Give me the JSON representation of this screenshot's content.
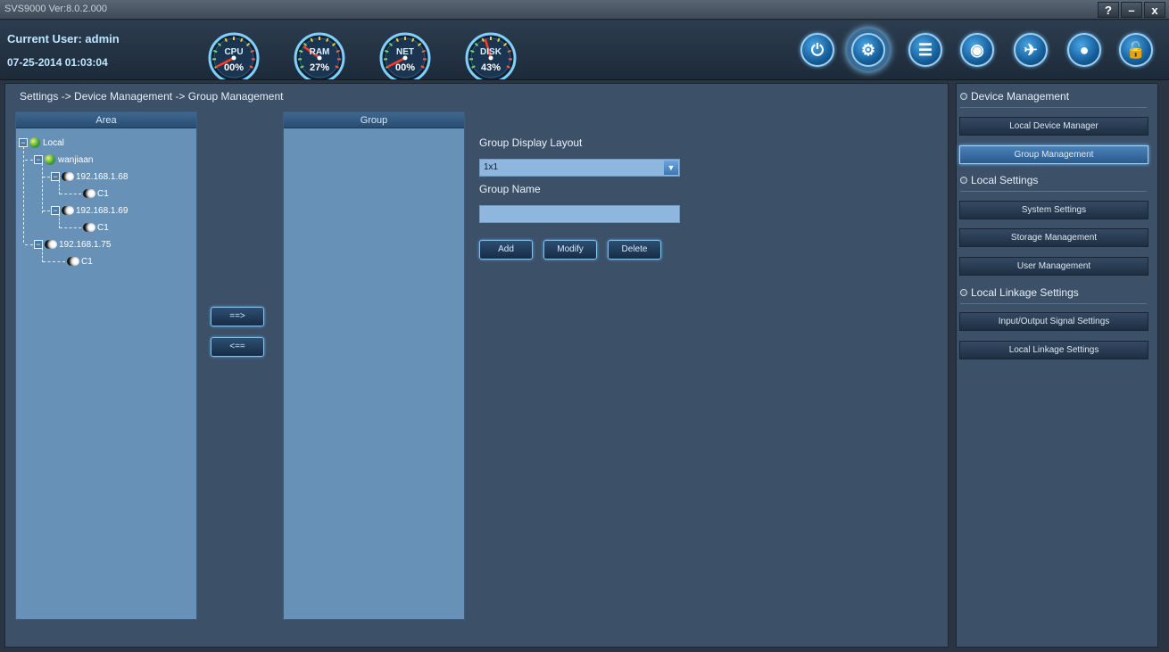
{
  "window": {
    "title": "SVS9000 Ver:8.0.2.000",
    "buttons": [
      "?",
      "–",
      "x"
    ]
  },
  "header": {
    "current_user": "Current User: admin",
    "datetime": "07-25-2014 01:03:04",
    "gauges": [
      {
        "label": "CPU",
        "value": "00%",
        "level": 0
      },
      {
        "label": "RAM",
        "value": "27%",
        "level": 0.27
      },
      {
        "label": "NET",
        "value": "00%",
        "level": 0
      },
      {
        "label": "DISK",
        "value": "43%",
        "level": 0.43
      }
    ],
    "toolbar_icons": [
      "power-icon",
      "settings-icon",
      "log-search-icon",
      "playback-icon",
      "map-icon",
      "camera-icon",
      "lock-icon"
    ]
  },
  "breadcrumb": "Settings -> Device Management -> Group Management",
  "area_panel": {
    "header": "Area",
    "tree": [
      {
        "label": "Local",
        "type": "globe"
      },
      {
        "label": "wanjiaan",
        "type": "globe"
      },
      {
        "label": "192.168.1.68",
        "type": "device"
      },
      {
        "label": "C1",
        "type": "camera"
      },
      {
        "label": "192.168.1.69",
        "type": "device"
      },
      {
        "label": "C1",
        "type": "camera"
      },
      {
        "label": "192.168.1.75",
        "type": "device"
      },
      {
        "label": "C1",
        "type": "camera"
      }
    ]
  },
  "transfer": {
    "add_label": "==>",
    "remove_label": "<=="
  },
  "group_panel": {
    "header": "Group"
  },
  "form": {
    "layout_label": "Group Display Layout",
    "layout_value": "1x1",
    "name_label": "Group Name",
    "name_value": "",
    "add_label": "Add",
    "modify_label": "Modify",
    "delete_label": "Delete"
  },
  "sidebar": {
    "sections": [
      {
        "title": "Device Management",
        "items": [
          "Local Device Manager",
          "Group Management"
        ]
      },
      {
        "title": "Local Settings",
        "items": [
          "System Settings",
          "Storage Management",
          "User Management"
        ]
      },
      {
        "title": "Local Linkage Settings",
        "items": [
          "Input/Output Signal Settings",
          "Local Linkage Settings"
        ]
      }
    ],
    "active_item": "Group Management"
  },
  "colors": {
    "accent": "#7fc0ee",
    "panel_bg": "#6891b8",
    "main_bg": "#3c5068"
  }
}
